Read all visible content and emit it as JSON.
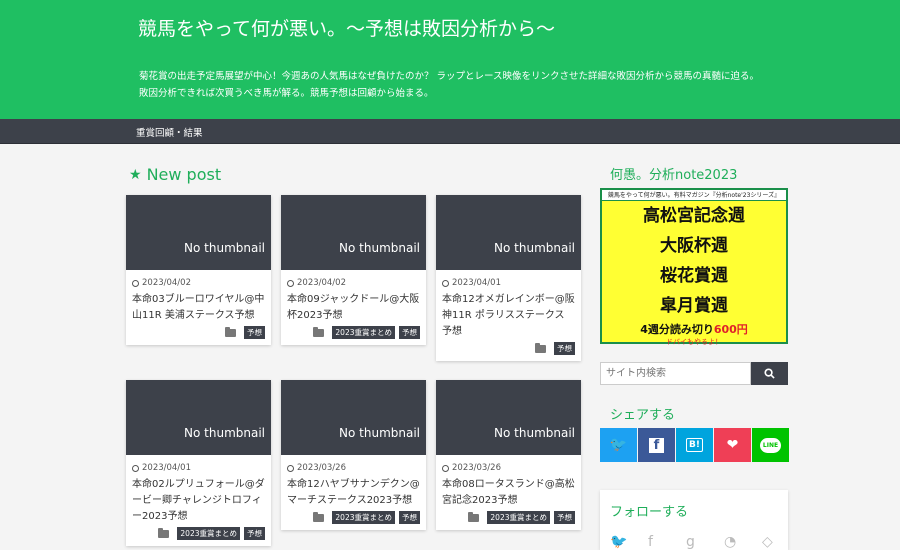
{
  "header": {
    "site_title": "競馬をやって何が悪い。〜予想は敗因分析から〜",
    "description_line1": "菊花賞の出走予定馬展望が中心！今週あの人気馬はなぜ負けたのか？ ラップとレース映像をリンクさせた詳細な敗因分析から競馬の真髄に迫る。",
    "description_line2": "敗因分析できれば次買うべき馬が解る。競馬予想は回顧から始まる。",
    "color": "#1fbf62"
  },
  "nav": {
    "items": [
      {
        "label": "重賞回顧・結果"
      }
    ]
  },
  "main": {
    "section_title": "New post",
    "thumbnail_text": "No thumbnail",
    "posts": [
      {
        "date": "2023/04/02",
        "title": "本命03ブルーロワイヤル@中山11R 美浦ステークス予想",
        "tags": [
          "予想"
        ]
      },
      {
        "date": "2023/04/02",
        "title": "本命09ジャックドール@大阪杯2023予想",
        "tags": [
          "2023重賞まとめ",
          "予想"
        ]
      },
      {
        "date": "2023/04/01",
        "title": "本命12オメガレインボー@阪神11R ポラリスステークス 予想",
        "tags": [
          "予想"
        ]
      },
      {
        "date": "2023/04/01",
        "title": "本命02ルプリュフォール@ダービー卿チャレンジトロフィー2023予想",
        "tags": [
          "2023重賞まとめ",
          "予想"
        ]
      },
      {
        "date": "2023/03/26",
        "title": "本命12ハヤブサナンデクン@マーチステークス2023予想",
        "tags": [
          "2023重賞まとめ",
          "予想"
        ]
      },
      {
        "date": "2023/03/26",
        "title": "本命08ロータスランド@高松宮記念2023予想",
        "tags": [
          "2023重賞まとめ",
          "予想"
        ]
      }
    ]
  },
  "sidebar": {
    "note_title": "何愚。分析note2023",
    "banner": {
      "top_text": "競馬をやって何が悪い。有料マガジン『分析note'23シリーズ』",
      "lines": [
        "高松宮記念週",
        "大阪杯週",
        "桜花賞週",
        "皐月賞週"
      ],
      "offer_prefix": "4週分読み切り",
      "offer_price": "600円",
      "note": "ドバイもやるよ！"
    },
    "search": {
      "placeholder": "サイト内検索"
    },
    "share_title": "シェアする",
    "share_buttons": [
      {
        "name": "twitter-icon",
        "color": "#1da1f2",
        "glyph": "🐦"
      },
      {
        "name": "facebook-icon",
        "color": "#3b5998",
        "glyph": "f"
      },
      {
        "name": "hatena-icon",
        "color": "#00a4de",
        "glyph": "B!"
      },
      {
        "name": "pocket-icon",
        "color": "#ef3f56",
        "glyph": "❤"
      },
      {
        "name": "line-icon",
        "color": "#00c300",
        "glyph": "LINE"
      }
    ],
    "follow_title": "フォローする"
  }
}
